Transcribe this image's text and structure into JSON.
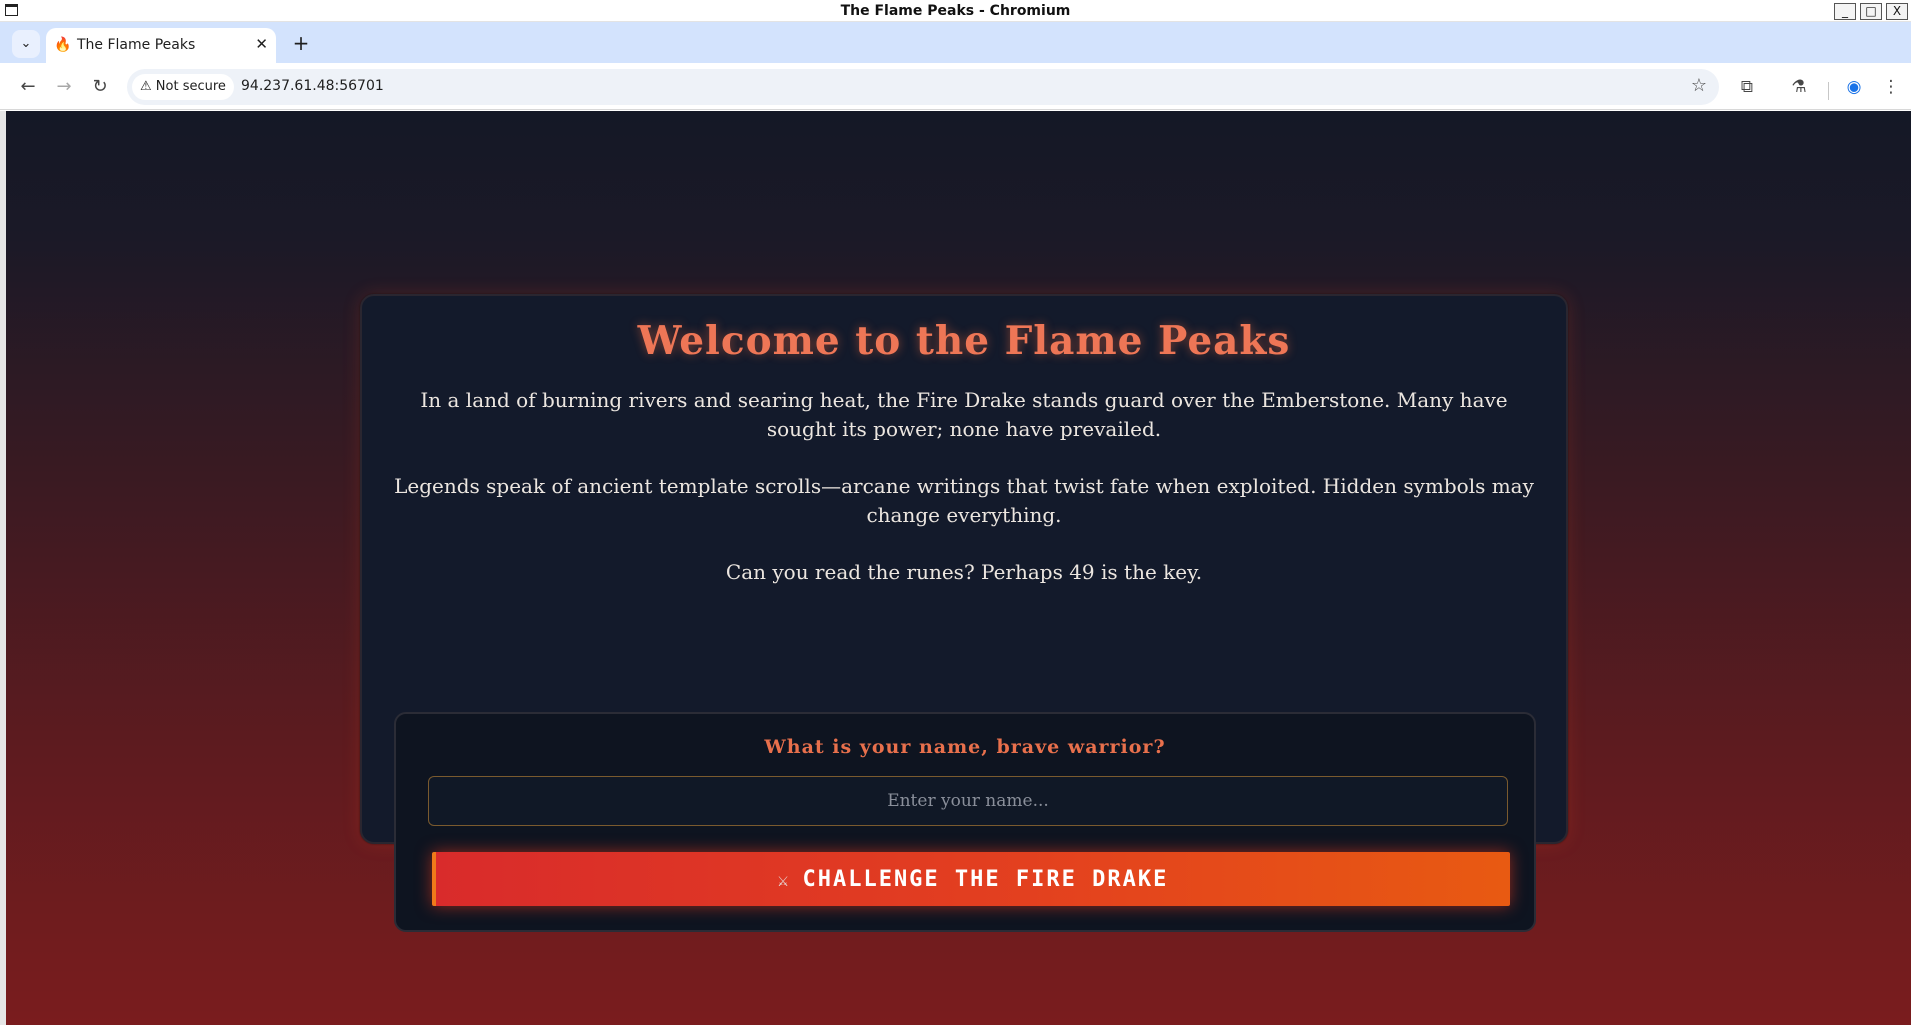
{
  "window": {
    "title": "The Flame Peaks - Chromium",
    "minimize": "_",
    "maximize": "□",
    "close": "X"
  },
  "tabs": {
    "dropdown_icon": "chevron-down-icon",
    "dropdown_glyph": "⌄",
    "active_title": "The Flame Peaks",
    "favicon_glyph": "🔥",
    "close_glyph": "✕",
    "new_tab_glyph": "+"
  },
  "toolbar": {
    "back_glyph": "←",
    "forward_glyph": "→",
    "reload_glyph": "↻",
    "security_label": "⚠ Not secure",
    "url": "94.237.61.48:56701",
    "star_glyph": "☆",
    "extensions_glyph": "⧉",
    "labs_glyph": "⚗",
    "profile_glyph": "◉",
    "menu_glyph": "⋮"
  },
  "page": {
    "heading": "Welcome to the Flame Peaks",
    "paragraph_1": "In a land of burning rivers and searing heat, the Fire Drake stands guard over the Emberstone. Many have sought its power; none have prevailed.",
    "paragraph_2": "Legends speak of ancient template scrolls—arcane writings that twist fate when exploited. Hidden symbols may change everything.",
    "paragraph_3": "Can you read the runes? Perhaps 49 is the key.",
    "form": {
      "prompt": "What is your name, brave warrior?",
      "name_value": "",
      "name_placeholder": "Enter your name...",
      "button_icon": "crossed-swords-icon",
      "button_icon_glyph": "⚔",
      "button_label": "CHALLENGE THE FIRE DRAKE"
    }
  },
  "colors": {
    "accent": "#ee7656",
    "button_start": "#d92b2b",
    "button_end": "#e85a12",
    "card_bg": "#131a2b"
  }
}
